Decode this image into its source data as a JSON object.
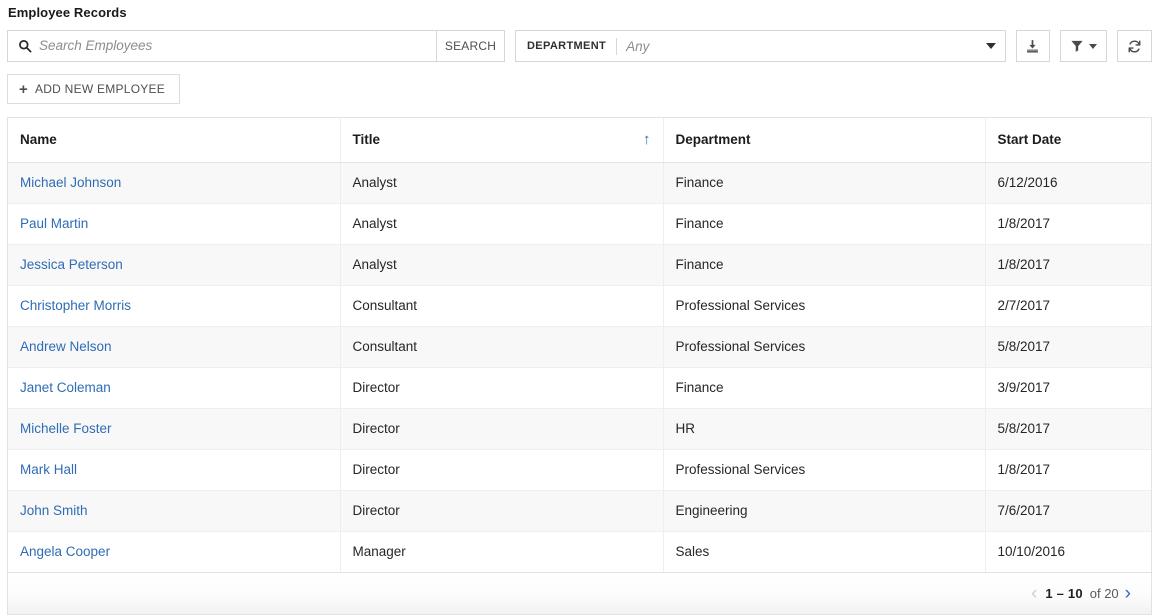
{
  "header": {
    "title": "Employee Records"
  },
  "toolbar": {
    "search": {
      "icon": "search-icon",
      "placeholder": "Search Employees",
      "value": "",
      "button_label": "SEARCH"
    },
    "department_filter": {
      "label": "DEPARTMENT",
      "value": "Any",
      "caret": "chevron-down-icon"
    },
    "actions": [
      {
        "name": "download-icon",
        "tooltip": "Download"
      },
      {
        "name": "filter-icon",
        "tooltip": "Filter"
      },
      {
        "name": "refresh-icon",
        "tooltip": "Refresh"
      }
    ],
    "add_button": {
      "plus": "+",
      "label": "ADD NEW EMPLOYEE"
    }
  },
  "table": {
    "columns": [
      {
        "key": "name",
        "label": "Name",
        "sorted": false
      },
      {
        "key": "title",
        "label": "Title",
        "sorted": true,
        "sort_direction": "asc",
        "sort_glyph": "↑"
      },
      {
        "key": "department",
        "label": "Department",
        "sorted": false
      },
      {
        "key": "start_date",
        "label": "Start Date",
        "sorted": false
      }
    ],
    "rows": [
      {
        "name": "Michael Johnson",
        "title": "Analyst",
        "department": "Finance",
        "start_date": "6/12/2016"
      },
      {
        "name": "Paul Martin",
        "title": "Analyst",
        "department": "Finance",
        "start_date": "1/8/2017"
      },
      {
        "name": "Jessica Peterson",
        "title": "Analyst",
        "department": "Finance",
        "start_date": "1/8/2017"
      },
      {
        "name": "Christopher Morris",
        "title": "Consultant",
        "department": "Professional Services",
        "start_date": "2/7/2017"
      },
      {
        "name": "Andrew Nelson",
        "title": "Consultant",
        "department": "Professional Services",
        "start_date": "5/8/2017"
      },
      {
        "name": "Janet Coleman",
        "title": "Director",
        "department": "Finance",
        "start_date": "3/9/2017"
      },
      {
        "name": "Michelle Foster",
        "title": "Director",
        "department": "HR",
        "start_date": "5/8/2017"
      },
      {
        "name": "Mark Hall",
        "title": "Director",
        "department": "Professional Services",
        "start_date": "1/8/2017"
      },
      {
        "name": "John Smith",
        "title": "Director",
        "department": "Engineering",
        "start_date": "7/6/2017"
      },
      {
        "name": "Angela Cooper",
        "title": "Manager",
        "department": "Sales",
        "start_date": "10/10/2016"
      }
    ]
  },
  "pagination": {
    "prev_glyph": "‹",
    "next_glyph": "›",
    "range": "1 – 10",
    "total": "of 20",
    "prev_enabled": false,
    "next_enabled": true
  },
  "colors": {
    "link": "#2f6cb4",
    "accent": "#2f6cb4",
    "border": "#e2e2e2",
    "row_alt": "#f8f8f8"
  }
}
